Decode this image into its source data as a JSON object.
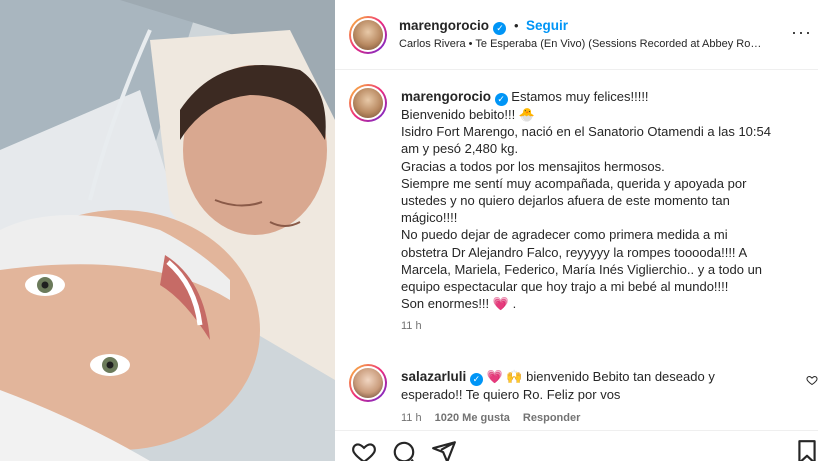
{
  "header": {
    "username": "marengorocio",
    "follow_label": "Seguir",
    "music": "Carlos Rivera • Te Esperaba (En Vivo) (Sessions Recorded at Abbey Ro…",
    "more_label": "···"
  },
  "caption": {
    "username": "marengorocio",
    "lines": [
      "Estamos muy felices!!!!!",
      "Bienvenido bebito!!! 🐣",
      "Isidro Fort Marengo, nació en el Sanatorio Otamendi a las 10:54",
      "am y pesó 2,480 kg.",
      "Gracias a todos por los mensajitos hermosos.",
      "Siempre me sentí muy acompañada, querida y apoyada por",
      "ustedes y no quiero dejarlos afuera de este momento tan",
      "mágico!!!!",
      "No puedo dejar de agradecer como primera medida a mi",
      "obstetra Dr Alejandro Falco, reyyyyy la rompes tooooda!!!! A",
      "Marcela, Mariela, Federico, María Inés Viglierchio.. y a todo un",
      "equipo espectacular que hoy trajo a mi bebé al mundo!!!!",
      "Son enormes!!!"
    ],
    "end_emoji": "💗",
    "end_dot": ".",
    "time": "11 h"
  },
  "comment": {
    "username": "salazarluli",
    "emoji": "💗 🙌",
    "text_line1": "bienvenido Bebito tan deseado y",
    "text_line2": "esperado!! Te quiero Ro. Feliz por vos",
    "time": "11 h",
    "likes": "1020 Me gusta",
    "reply": "Responder"
  },
  "colors": {
    "accent": "#0095f6",
    "heart": "#ed4956",
    "text": "#262626",
    "muted": "#737373"
  },
  "icons": [
    "heart-icon",
    "comment-icon",
    "share-icon",
    "bookmark-icon",
    "verified-icon",
    "more-icon"
  ]
}
